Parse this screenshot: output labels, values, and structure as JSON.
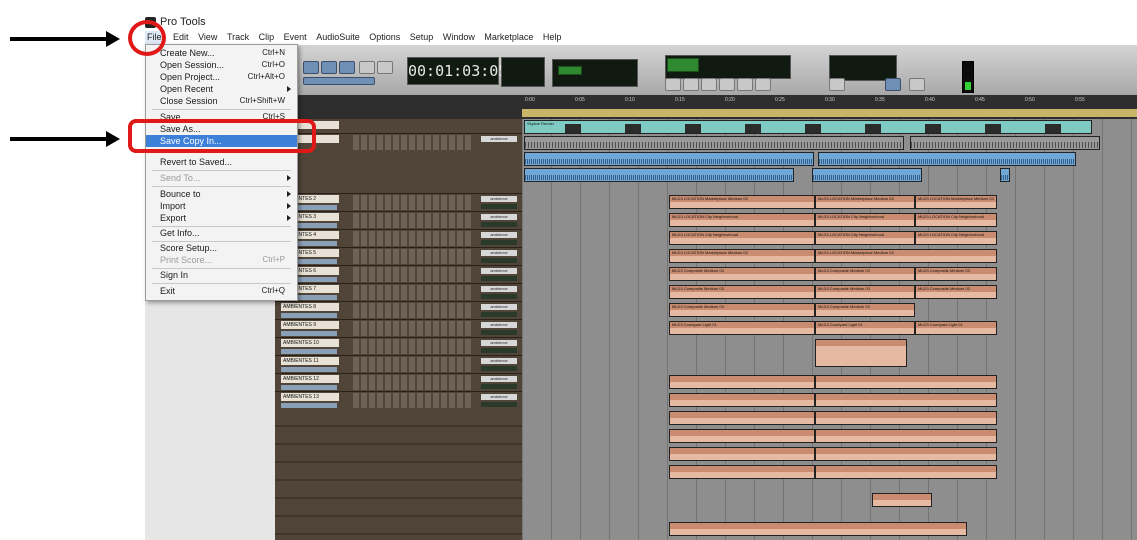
{
  "window": {
    "title": "Pro Tools"
  },
  "menubar": [
    "File",
    "Edit",
    "View",
    "Track",
    "Clip",
    "Event",
    "AudioSuite",
    "Options",
    "Setup",
    "Window",
    "Marketplace",
    "Help"
  ],
  "file_menu": {
    "items": [
      {
        "label": "Create New...",
        "shortcut": "Ctrl+N"
      },
      {
        "label": "Open Session...",
        "shortcut": "Ctrl+O"
      },
      {
        "label": "Open Project...",
        "shortcut": "Ctrl+Alt+O"
      },
      {
        "label": "Open Recent",
        "shortcut": ""
      },
      {
        "label": "Close Session",
        "shortcut": "Ctrl+Shift+W"
      },
      {
        "label": "Save",
        "shortcut": "Ctrl+S"
      },
      {
        "label": "Save As...",
        "shortcut": ""
      },
      {
        "label": "Save Copy In...",
        "shortcut": ""
      },
      {
        "label": "Revert to Saved...",
        "shortcut": ""
      },
      {
        "label": "Send To...",
        "shortcut": ""
      },
      {
        "label": "Bounce to",
        "shortcut": ""
      },
      {
        "label": "Import",
        "shortcut": ""
      },
      {
        "label": "Export",
        "shortcut": ""
      },
      {
        "label": "Get Info...",
        "shortcut": ""
      },
      {
        "label": "Score Setup...",
        "shortcut": ""
      },
      {
        "label": "Print Score...",
        "shortcut": "Ctrl+P"
      },
      {
        "label": "Sign In",
        "shortcut": ""
      },
      {
        "label": "Exit",
        "shortcut": "Ctrl+Q"
      }
    ]
  },
  "transport": {
    "main_counter": "00:01:03:05"
  },
  "tracks": {
    "names": [
      "AMBIENTES 2",
      "AMBIENTES 3",
      "AMBIENTES 4",
      "AMBIENTES 5",
      "AMBIENTES 6",
      "AMBIENTES 7",
      "AMBIENTES 8",
      "AMBIENTES 9",
      "AMBIENTES 10",
      "AMBIENTES 11",
      "AMBIENTES 12",
      "AMBIENTES 13"
    ],
    "io_label": "ambience"
  },
  "clips": {
    "video": "Skyline Render",
    "loc_a": "MLD3 LOCATION Marketplace Medium 03",
    "loc_b": "MLD3 LOCATION City Neighborhood",
    "loc_c": "MLD3 Composite Medium 03",
    "loc_d": "MLD3 Courtyard Light 01"
  },
  "colors": {
    "highlight": "#3d80d8",
    "annotation": "#e01818",
    "clip_peach": "#e6b9a3",
    "clip_video": "#7fcbc4",
    "clip_audio": "#6fa7d6"
  }
}
